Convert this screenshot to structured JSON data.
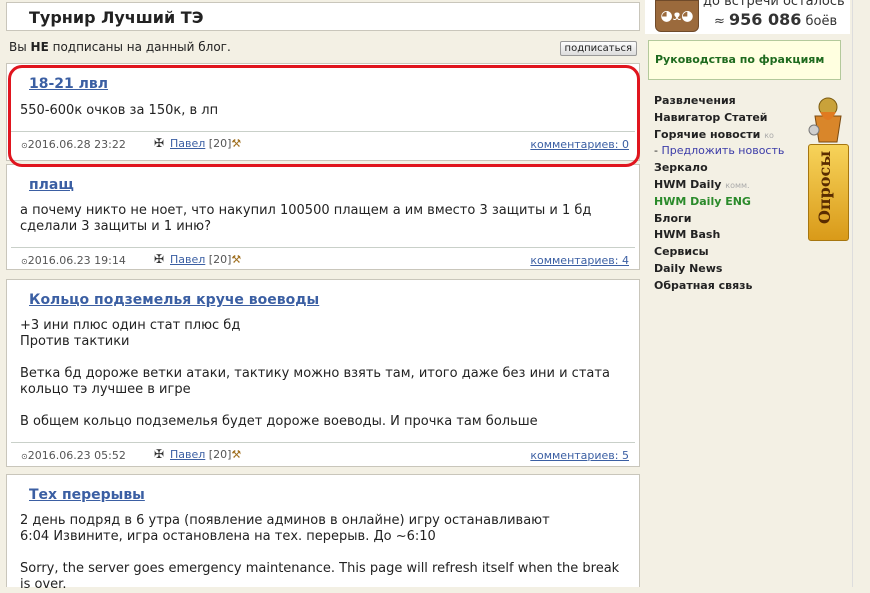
{
  "page": {
    "title": "Турнир Лучший ТЭ"
  },
  "subscription": {
    "text_pre": "Вы ",
    "text_bold": "НЕ",
    "text_post": " подписаны на данный блог.",
    "button": "подписаться"
  },
  "posts": [
    {
      "title": "18-21 лвл",
      "body": "550-600к очков за 150к, в лп",
      "date": "2016.06.28 23:22",
      "author": "Павел",
      "level": "[20]",
      "comments": "комментариев: 0"
    },
    {
      "title": "плащ",
      "body": "а почему никто не ноет, что накупил 100500 плащем а им вместо 3 защиты и 1 бд\nсделали 3 защиты и 1 иню?",
      "date": "2016.06.23 19:14",
      "author": "Павел",
      "level": "[20]",
      "comments": "комментариев: 4"
    },
    {
      "title": "Кольцо подземелья круче воеводы",
      "body": "+3 ини плюс один стат плюс бд\nПротив тактики\n\nВетка бд дороже ветки атаки, тактику можно взять там, итого даже без ини и стата\nкольцо тэ лучшее в игре\n\nВ общем кольцо подземелья будет дороже воеводы. И прочка там больше",
      "date": "2016.06.23 05:52",
      "author": "Павел",
      "level": "[20]",
      "comments": "комментариев: 5"
    },
    {
      "title": "Тех перерывы",
      "body": "2 день подряд в 6 утра (появление админов в онлайне) игру останавливают\n6:04 Извините, игра остановлена на тех. перерыв. До ~6:10\n\nSorry, the server goes emergency maintenance. This page will refresh itself when the break\nis over."
    }
  ],
  "sidebar": {
    "until_text": "до встречи осталось",
    "count_prefix": "≈ ",
    "count_value": "956 086",
    "count_suffix": " боёв",
    "guide": "Руководства по фракциям",
    "menu": [
      {
        "label": "Развлечения"
      },
      {
        "label": "Навигатор Статей"
      },
      {
        "label": "Горячие новости",
        "extra": "ко"
      },
      {
        "label": "Предложить новость",
        "prefix": "- "
      },
      {
        "label": "Зеркало"
      },
      {
        "label": "HWM Daily",
        "extra": "комм."
      },
      {
        "label": "HWM Daily ENG"
      },
      {
        "label": "Блоги"
      },
      {
        "label": "HWM Bash"
      },
      {
        "label": "Сервисы"
      },
      {
        "label": "Daily News"
      },
      {
        "label": "Обратная связь"
      }
    ],
    "polls": "Опросы"
  },
  "colors": {
    "link": "#3b5fa3",
    "highlight": "#e0151e",
    "accent_green": "#2a8a2a"
  },
  "icons": {
    "clock": "clock-icon",
    "class": "class-icon",
    "hammer": "hammer-icon"
  }
}
